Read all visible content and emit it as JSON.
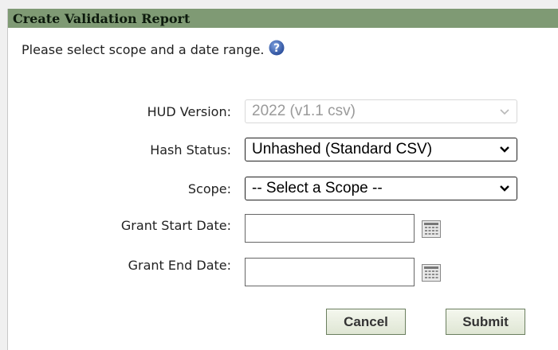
{
  "dialog": {
    "title": "Create Validation Report",
    "intro": "Please select scope and a date range."
  },
  "form": {
    "hud_version": {
      "label": "HUD Version:",
      "value": "2022 (v1.1 csv)",
      "disabled": true
    },
    "hash_status": {
      "label": "Hash Status:",
      "value": "Unhashed (Standard CSV)"
    },
    "scope": {
      "label": "Scope:",
      "value": "-- Select a Scope --"
    },
    "grant_start_date": {
      "label": "Grant Start Date:",
      "value": ""
    },
    "grant_end_date": {
      "label": "Grant End Date:",
      "value": ""
    }
  },
  "buttons": {
    "cancel": "Cancel",
    "submit": "Submit"
  },
  "icons": {
    "help": "help-icon",
    "calendar": "calendar-icon",
    "dropdown": "chevron-down-icon"
  },
  "colors": {
    "title_bar": "#7f9a74",
    "help_icon": "#3a5faa",
    "button_border": "#6b7f5f"
  }
}
